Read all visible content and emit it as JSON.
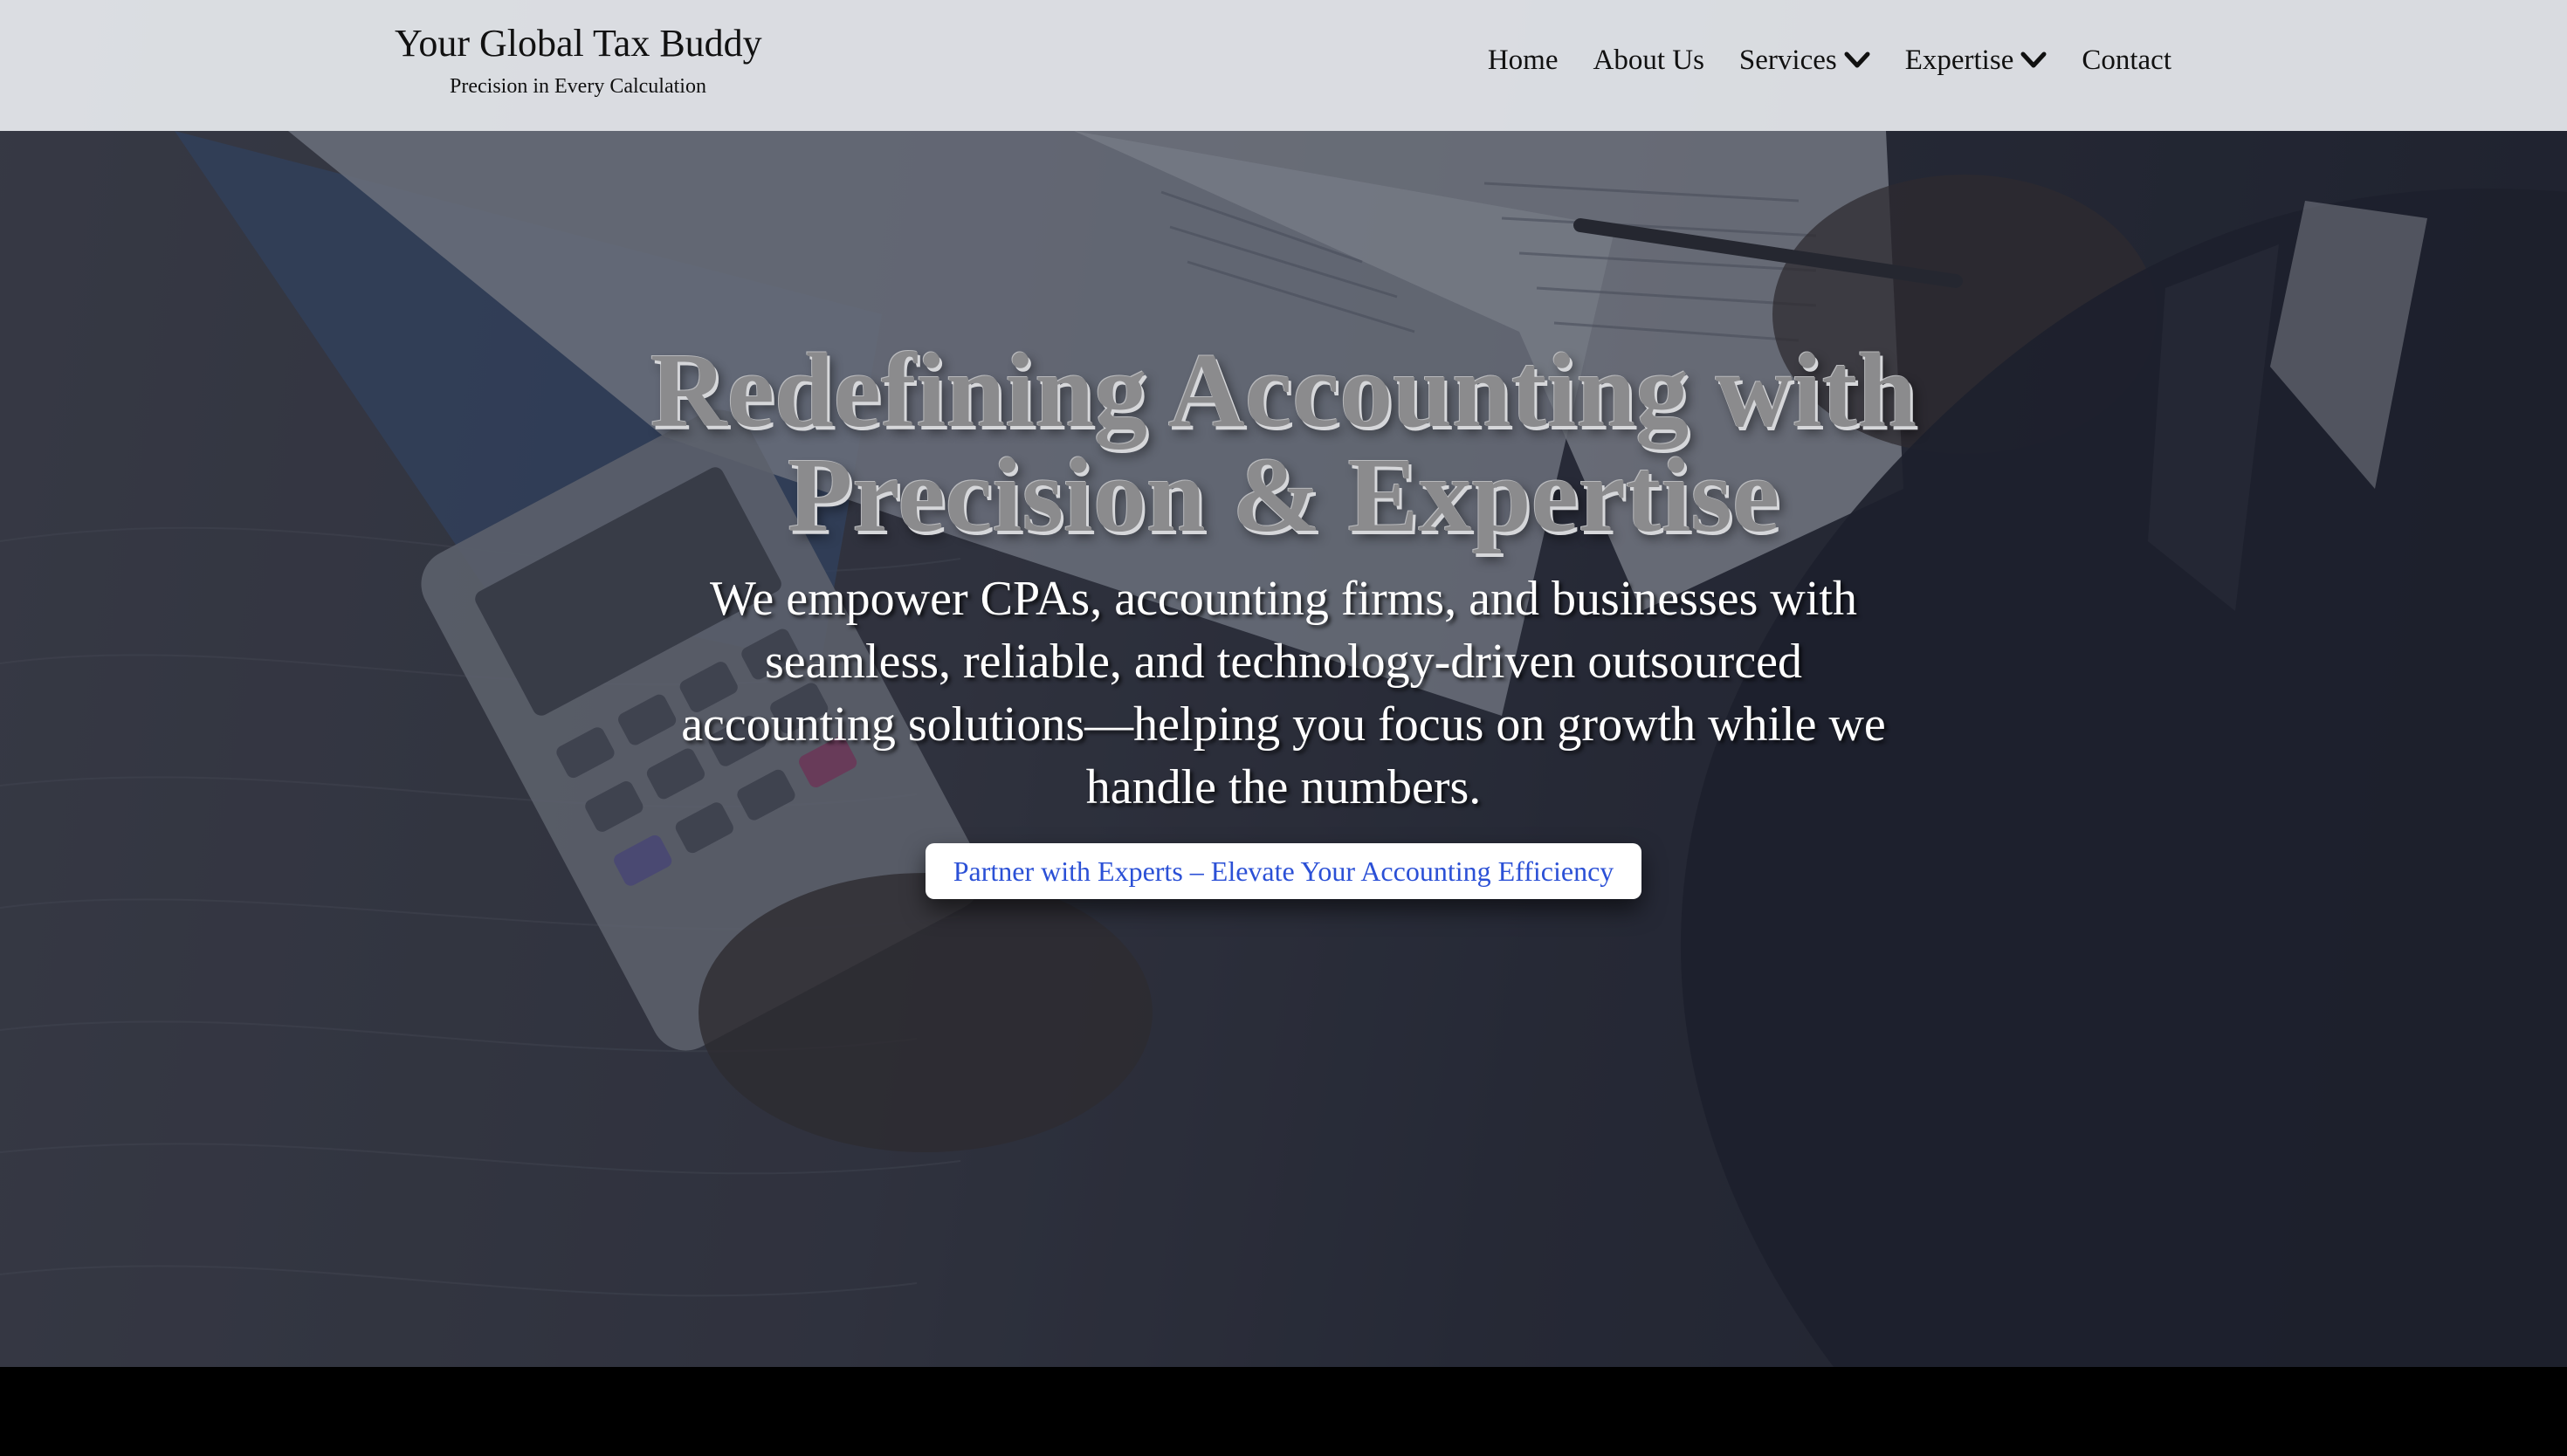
{
  "header": {
    "brand_title": "Your Global Tax Buddy",
    "brand_tagline": "Precision in Every Calculation",
    "nav": [
      {
        "label": "Home",
        "has_dropdown": false
      },
      {
        "label": "About Us",
        "has_dropdown": false
      },
      {
        "label": "Services",
        "has_dropdown": true
      },
      {
        "label": "Expertise",
        "has_dropdown": true
      },
      {
        "label": "Contact",
        "has_dropdown": false
      }
    ]
  },
  "hero": {
    "title_line1": "Redefining Accounting with",
    "title_line2": "Precision & Expertise",
    "subtitle": "We empower CPAs, accounting firms, and businesses with seamless, reliable, and technology-driven outsourced accounting solutions—helping you focus on growth while we handle the numbers.",
    "cta_label": "Partner with Experts – Elevate Your Accounting Efficiency",
    "background_image": "accountant-with-calculator-and-documents"
  },
  "colors": {
    "header_bg": "#e7eaee",
    "cta_text": "#2b50d6",
    "title_text": "#8b8b8d",
    "footer_band": "#000000"
  }
}
